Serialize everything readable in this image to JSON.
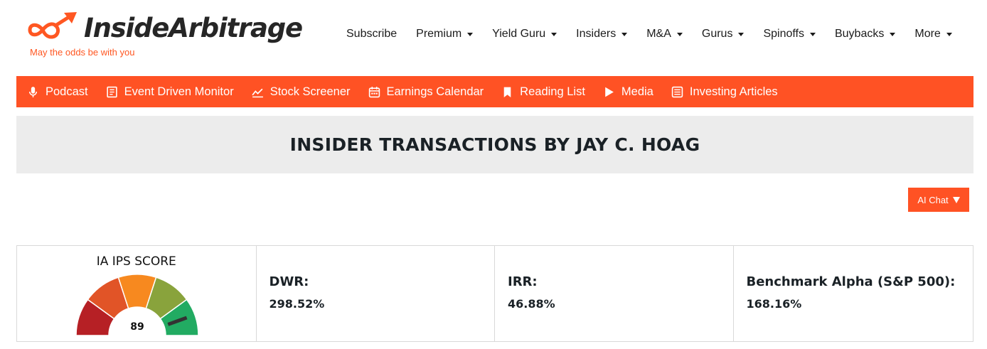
{
  "brand": {
    "name": "InsideArbitrage",
    "tagline": "May the odds be with you"
  },
  "nav": {
    "items": [
      {
        "label": "Subscribe",
        "dropdown": false
      },
      {
        "label": "Premium",
        "dropdown": true
      },
      {
        "label": "Yield Guru",
        "dropdown": true
      },
      {
        "label": "Insiders",
        "dropdown": true
      },
      {
        "label": "M&A",
        "dropdown": true
      },
      {
        "label": "Gurus",
        "dropdown": true
      },
      {
        "label": "Spinoffs",
        "dropdown": true
      },
      {
        "label": "Buybacks",
        "dropdown": true
      },
      {
        "label": "More",
        "dropdown": true
      }
    ]
  },
  "toolbar": {
    "items": [
      {
        "label": "Podcast",
        "icon": "microphone-icon"
      },
      {
        "label": "Event Driven Monitor",
        "icon": "document-icon"
      },
      {
        "label": "Stock Screener",
        "icon": "chart-line-icon"
      },
      {
        "label": "Earnings Calendar",
        "icon": "calendar-icon"
      },
      {
        "label": "Reading List",
        "icon": "bookmark-icon"
      },
      {
        "label": "Media",
        "icon": "play-icon"
      },
      {
        "label": "Investing Articles",
        "icon": "list-icon"
      }
    ]
  },
  "page": {
    "title": "INSIDER TRANSACTIONS BY JAY C. HOAG"
  },
  "ai_chat": {
    "label": "AI Chat"
  },
  "score": {
    "title": "IA IPS SCORE",
    "value": 89,
    "max": 100,
    "segment_colors": [
      "#b62025",
      "#e15427",
      "#f7891f",
      "#89a33c",
      "#22ab62"
    ]
  },
  "metrics": [
    {
      "label": "DWR:",
      "value": "298.52%"
    },
    {
      "label": "IRR:",
      "value": "46.88%"
    },
    {
      "label": "Benchmark Alpha (S&P 500):",
      "value": "168.16%"
    }
  ],
  "colors": {
    "accent": "#ff5224",
    "title_band": "#ececec",
    "text_dark": "#1a2126"
  }
}
